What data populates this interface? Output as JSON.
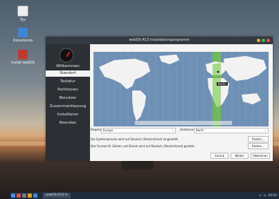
{
  "desktop": {
    "icons": [
      {
        "label": "Tys",
        "icon": "trash-icon"
      },
      {
        "label": "Documents",
        "icon": "folder-icon"
      },
      {
        "label": "Install webOS",
        "icon": "installer-icon"
      }
    ]
  },
  "window": {
    "title": "webOS-R13 Installationsprogramm",
    "titlebar_button_colors": [
      "#e0b040",
      "#4caf50",
      "#e05050"
    ]
  },
  "sidebar": {
    "items": [
      {
        "label": "Willkommen",
        "active": false
      },
      {
        "label": "Standort",
        "active": true
      },
      {
        "label": "Tastatur",
        "active": false
      },
      {
        "label": "Partitionen",
        "active": false
      },
      {
        "label": "Benutzer",
        "active": false
      },
      {
        "label": "Zusammenfassung",
        "active": false
      },
      {
        "label": "Installieren",
        "active": false
      },
      {
        "label": "Beenden",
        "active": false
      }
    ]
  },
  "map": {
    "selected_timezone_label": "Berlin",
    "timezone_highlight_color": "#6fbf4f",
    "ocean_color": "#6f90b5",
    "land_color": "#f2f2f2"
  },
  "location": {
    "region_label": "Region:",
    "region_value": "Europe",
    "zone_label": "Zeitzone:",
    "zone_value": "Berlin",
    "language_info": "Die Systemsprache wird auf Deutsch (Deutschland) eingestellt.",
    "format_info": "Das Format für Zahlen und Datum wird auf Deutsch (Deutschland) gesetzt.",
    "change_button_1": "Ändern...",
    "change_button_2": "Ändern..."
  },
  "footer": {
    "back": "Zurück",
    "next": "Weiter",
    "cancel": "Abbrechen"
  },
  "taskbar": {
    "task_label": "webOS-R13 In",
    "clock": "19:52"
  }
}
